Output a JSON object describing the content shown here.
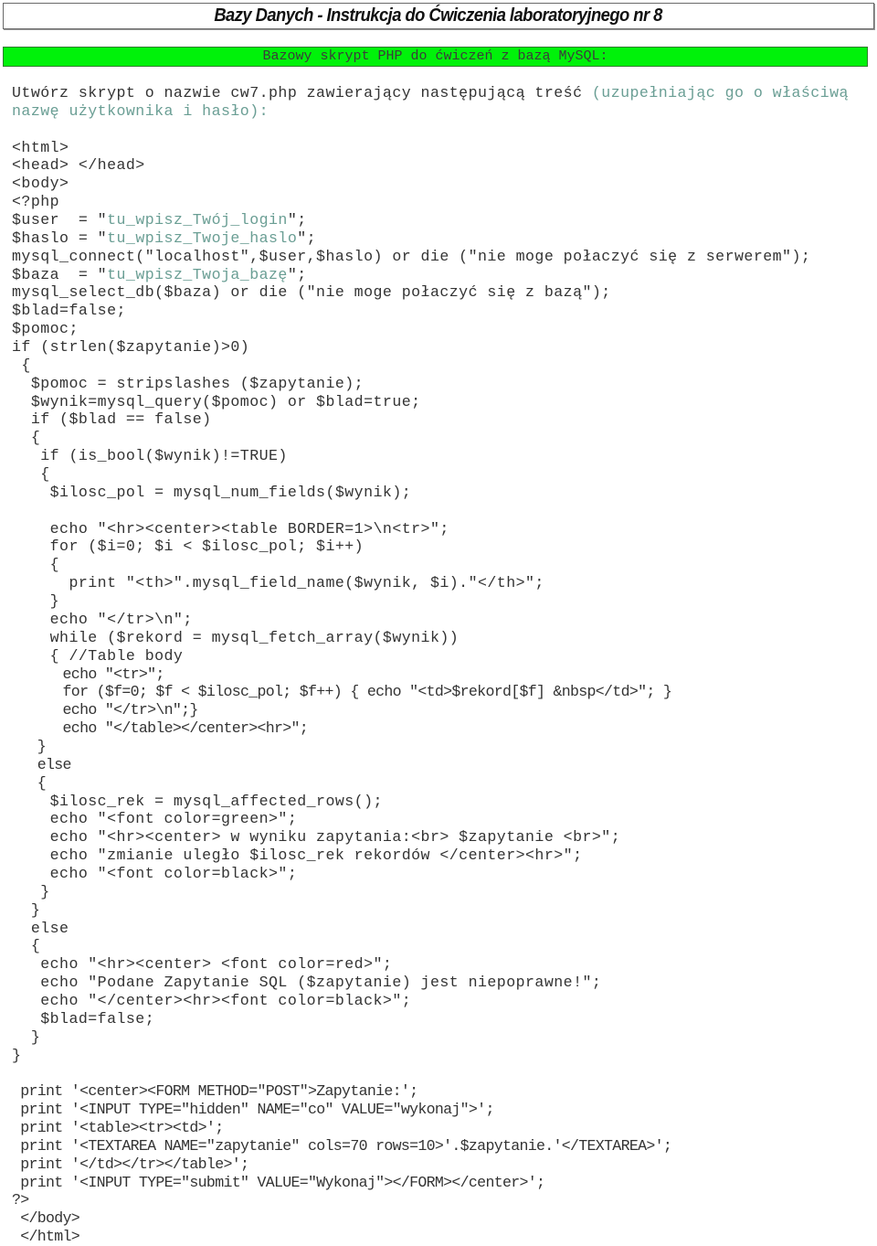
{
  "header": {
    "title": "Bazy Danych - Instrukcja do Ćwiczenia laboratoryjnego nr 8",
    "section_title": "Bazowy skrypt PHP do ćwiczeń z bazą MySQL:"
  },
  "intro": {
    "text_main": "Utwórz skrypt o nazwie cw7.php zawierający następującą treść ",
    "text_hint_line1": "(uzupełniając go o właściwą",
    "text_hint_line2": "nazwę użytkownika i hasło):"
  },
  "colors": {
    "section_background": "#00f20a",
    "hint_text": "#6a9e94",
    "body_text": "#333333"
  },
  "code": {
    "user_prefix": "$user  = \"",
    "user_value": "tu_wpisz_Twój_login",
    "user_suffix": "\";",
    "haslo_prefix": "$haslo = \"",
    "haslo_value": "tu_wpisz_Twoje_haslo",
    "haslo_suffix": "\";",
    "baza_prefix": "$baza  = \"",
    "baza_value": "tu_wpisz_Twoja_bazę",
    "baza_suffix": "\";",
    "lines_before": [
      "<html>",
      "<head> </head>",
      "<body>",
      "<?php"
    ],
    "line_connect": "mysql_connect(\"localhost\",$user,$haslo) or die (\"nie moge połaczyć się z serwerem\");",
    "lines_after": [
      "mysql_select_db($baza) or die (\"nie moge połaczyć się z bazą\");",
      "$blad=false;",
      "$pomoc;",
      "if (strlen($zapytanie)>0)",
      " {",
      "  $pomoc = stripslashes ($zapytanie);",
      "  $wynik=mysql_query($pomoc) or $blad=true;",
      "  if ($blad == false)",
      "  {",
      "   if (is_bool($wynik)!=TRUE)",
      "   {",
      "    $ilosc_pol = mysql_num_fields($wynik);",
      "",
      "    echo \"<hr><center><table BORDER=1>\\n<tr>\";",
      "    for ($i=0; $i < $ilosc_pol; $i++)",
      "    {",
      "      print \"<th>\".mysql_field_name($wynik, $i).\"</th>\";",
      "    }",
      "    echo \"</tr>\\n\";",
      "    while ($rekord = mysql_fetch_array($wynik))",
      "    { //Table body"
    ],
    "lines_condensed": [
      "      echo \"<tr>\";",
      "      for ($f=0; $f < $ilosc_pol; $f++) { echo \"<td>$rekord[$f] &nbsp</td>\"; }",
      "      echo \"</tr>\\n\";}",
      "      echo \"</table></center><hr>\";",
      "   }",
      "   else",
      "   {"
    ],
    "lines_else_block": [
      "    $ilosc_rek = mysql_affected_rows();",
      "    echo \"<font color=green>\";",
      "    echo \"<hr><center> w wyniku zapytania:<br> $zapytanie <br>\";",
      "    echo \"zmianie uległo $ilosc_rek rekordów </center><hr>\";",
      "    echo \"<font color=black>\";",
      "   }",
      "  }",
      "  else",
      "  {",
      "   echo \"<hr><center> <font color=red>\";",
      "   echo \"Podane Zapytanie SQL ($zapytanie) jest niepoprawne!\";",
      "   echo \"</center><hr><font color=black>\";",
      "   $blad=false;",
      "  }",
      "}",
      ""
    ],
    "lines_form": [
      " print '<center><FORM METHOD=\"POST\">Zapytanie:';",
      " print '<INPUT TYPE=\"hidden\" NAME=\"co\" VALUE=\"wykonaj\">';",
      " print '<table><tr><td>';",
      " print '<TEXTAREA NAME=\"zapytanie\" cols=70 rows=10>'.$zapytanie.'</TEXTAREA>';",
      " print '</td></tr></table>';",
      " print '<INPUT TYPE=\"submit\" VALUE=\"Wykonaj\"></FORM></center>';",
      "?>",
      " </body>",
      " </html>"
    ]
  }
}
